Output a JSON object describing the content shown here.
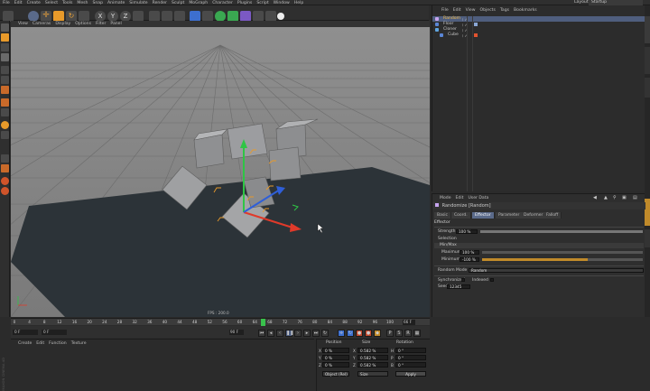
{
  "app": {
    "menubar": [
      "File",
      "Edit",
      "Create",
      "Select",
      "Tools",
      "Mesh",
      "Snap",
      "Animate",
      "Simulate",
      "Render",
      "Sculpt",
      "MoGraph",
      "Character",
      "Plugins",
      "Script",
      "Window",
      "Help"
    ],
    "layout_label": "Layout:",
    "layout_value": "Startup"
  },
  "viewport": {
    "menu": [
      "View",
      "Cameras",
      "Display",
      "Options",
      "Filter",
      "Panel"
    ],
    "camera_label": "Perspective",
    "fps": "FPS : 200.0"
  },
  "object_manager": {
    "menu": [
      "File",
      "Edit",
      "View",
      "Objects",
      "Tags",
      "Bookmarks"
    ],
    "objects": [
      {
        "name": "Random",
        "selected": true,
        "indent": 0
      },
      {
        "name": "Floor",
        "selected": false,
        "indent": 0
      },
      {
        "name": "Cloner",
        "selected": false,
        "indent": 0
      },
      {
        "name": "Cube",
        "selected": false,
        "indent": 1
      }
    ]
  },
  "attribute_manager": {
    "menu": [
      "Mode",
      "Edit",
      "User Data"
    ],
    "title": "Randomize [Random]",
    "tabs": [
      "Basic",
      "Coord.",
      "Effector",
      "Parameter",
      "Deformer",
      "Falloff"
    ],
    "active_tab": "Effector",
    "section": "Effector",
    "strength_label": "Strength",
    "strength_value": "100 %",
    "selection_label": "Selection",
    "minmax_label": "Min/Max",
    "maximum_label": "Maximum",
    "maximum_value": "100 %",
    "minimum_label": "Minimum",
    "minimum_value": "-100 %",
    "minimum_fill": 0.66,
    "random_mode_label": "Random Mode",
    "random_mode_value": "Random",
    "synchronized_label": "Synchronized",
    "indexed_label": "Indexed",
    "seed_label": "Seed",
    "seed_value": "12345"
  },
  "timeline": {
    "ticks": [
      "0",
      "4",
      "8",
      "12",
      "16",
      "20",
      "24",
      "28",
      "32",
      "36",
      "40",
      "44",
      "48",
      "52",
      "56",
      "60",
      "64",
      "68",
      "72",
      "76",
      "80",
      "84",
      "88",
      "92",
      "96",
      "100"
    ],
    "playhead_frame": 66,
    "end_frame_label": "66 F",
    "start_field": "0 F",
    "current_field": "0 F",
    "end_field": "90 F",
    "end_field2": "90 F"
  },
  "material_manager": {
    "menu": [
      "Create",
      "Edit",
      "Function",
      "Texture"
    ]
  },
  "coordinates": {
    "headers": [
      "Position",
      "Size",
      "Rotation"
    ],
    "rows": [
      {
        "axis": "X",
        "pos": "0 %",
        "size_axis": "X",
        "size": "0.582 %",
        "rot_axis": "H",
        "rot": "0 °"
      },
      {
        "axis": "Y",
        "pos": "0 %",
        "size_axis": "Y",
        "size": "0.582 %",
        "rot_axis": "P",
        "rot": "0 °"
      },
      {
        "axis": "Z",
        "pos": "0 %",
        "size_axis": "Z",
        "size": "0.582 %",
        "rot_axis": "B",
        "rot": "0 °"
      }
    ],
    "mode_dropdown": "Object (Rel)",
    "size_dropdown": "Size",
    "apply_label": "Apply"
  },
  "side_tabs": [
    "Objects",
    "Content Browser",
    "Structure",
    "Attributes",
    "Layers"
  ],
  "watermark": "MAXON CINEMA 4D",
  "colors": {
    "bg": "#2b2b2b",
    "viewport_floor": "#2c3338",
    "grid_bg": "#8b8b8b",
    "selection_blue": "#5a6a8a",
    "playhead": "#39c14c",
    "axis_y": "#2fc545",
    "axis_x": "#e03a2a",
    "axis_z": "#2f5fd8",
    "orange": "#e89a2a"
  }
}
